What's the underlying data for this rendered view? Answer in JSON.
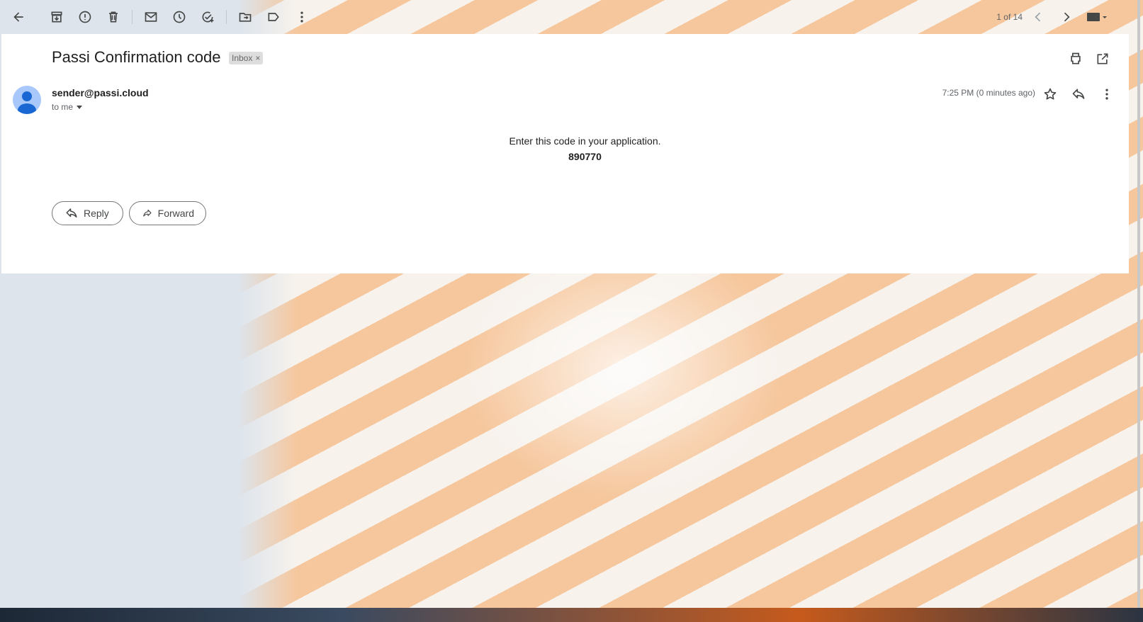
{
  "toolbar": {
    "counter": "1 of 14",
    "icons": [
      "back-arrow-icon",
      "archive-icon",
      "report-spam-icon",
      "delete-icon",
      "mark-unread-icon",
      "snooze-icon",
      "add-task-icon",
      "move-to-icon",
      "label-icon",
      "more-vert-icon",
      "newer-chevron-icon",
      "older-chevron-icon",
      "keyboard-icon"
    ]
  },
  "message": {
    "subject": "Passi Confirmation code",
    "label_chip": "Inbox",
    "sender": "sender@passi.cloud",
    "recipient": "to me",
    "time": "7:25 PM (0 minutes ago)",
    "body_line": "Enter this code in your application.",
    "code": "890770"
  },
  "actions": {
    "reply_label": "Reply",
    "forward_label": "Forward"
  },
  "colors": {
    "card": "#ffffff",
    "text": "#1f1f1f",
    "muted": "#5f6368",
    "avatar_bg": "#a8c7fa",
    "avatar_fg": "#1967d2",
    "stripe_orange": "#f6c79d"
  }
}
